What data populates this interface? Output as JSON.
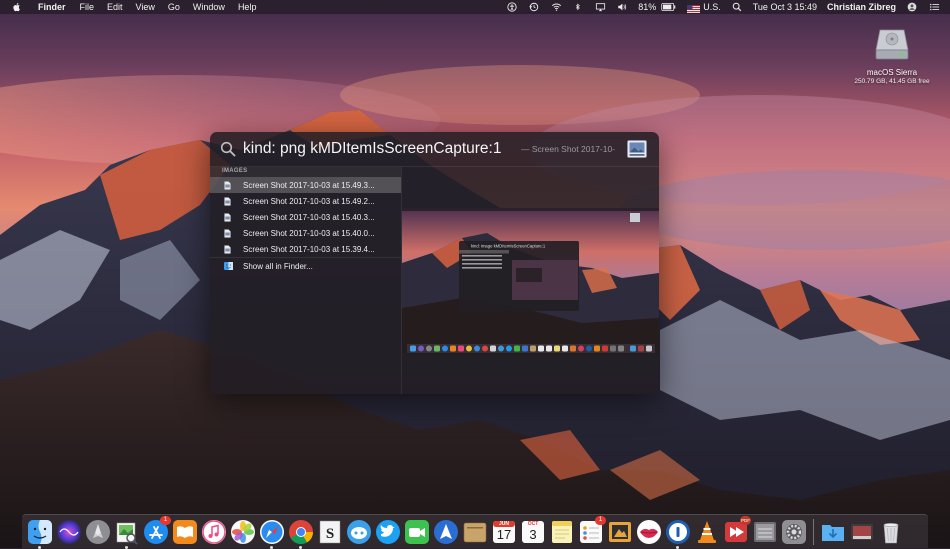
{
  "menubar": {
    "app_name": "Finder",
    "menus": [
      "File",
      "Edit",
      "View",
      "Go",
      "Window",
      "Help"
    ],
    "battery": "81%",
    "input_source": "U.S.",
    "datetime": "Tue Oct 3  15:49",
    "user": "Christian Zibreg",
    "status_icons": [
      "accessibility-icon",
      "time-machine-icon",
      "wifi-icon",
      "bluetooth-icon",
      "airplay-icon",
      "volume-icon",
      "battery-icon",
      "flag-us-icon",
      "spotlight-icon",
      "user-icon",
      "notification-center-icon"
    ]
  },
  "desktop": {
    "drive": {
      "name": "macOS Sierra",
      "info": "250.79 GB, 41.45 GB free"
    }
  },
  "spotlight": {
    "query": "kind: png kMDItemIsScreenCapture:1",
    "suggestion": "— Screen Shot 2017-10-",
    "section": "IMAGES",
    "results": [
      "Screen Shot 2017-10-03 at 15.49.3...",
      "Screen Shot 2017-10-03 at 15.49.2...",
      "Screen Shot 2017-10-03 at 15.40.3...",
      "Screen Shot 2017-10-03 at 15.40.0...",
      "Screen Shot 2017-10-03 at 15.39.4..."
    ],
    "selected_index": 0,
    "show_all": "Show all in Finder...",
    "preview": {
      "mini_query": "kind: image kMDItemIsScreenCapture:1"
    }
  },
  "dock": {
    "apps": [
      "finder-icon",
      "siri-icon",
      "launchpad-icon",
      "preview-icon",
      "app-store-icon",
      "ibooks-icon",
      "itunes-icon",
      "photos-icon",
      "safari-icon",
      "chrome-icon",
      "scrivener-icon",
      "tweetbot-icon",
      "twitter-icon",
      "facetime-icon",
      "maps-icon",
      "notefile-icon",
      "fantastical-icon",
      "calendar-icon",
      "notes-icon",
      "reminders-icon",
      "pixelmator-icon",
      "kiss-icon",
      "1password-icon",
      "vlc-icon",
      "speed-download-icon",
      "preferences-icon",
      "system-preferences-icon",
      "downloads-folder-icon",
      "photo-booth-icon",
      "trash-icon"
    ],
    "app_store_badge": "1",
    "reminders_badge": "1",
    "calendar_month": "JUN",
    "calendar_day": "17",
    "calendar2_month": "OCT",
    "calendar2_day": "3",
    "pdf_badge": "PDF"
  },
  "colors": {
    "sky_top": "#3a2a4a",
    "sunset": "#e07858",
    "mountain_lit": "#e0603a",
    "spotlight_bg": "#221e24"
  }
}
